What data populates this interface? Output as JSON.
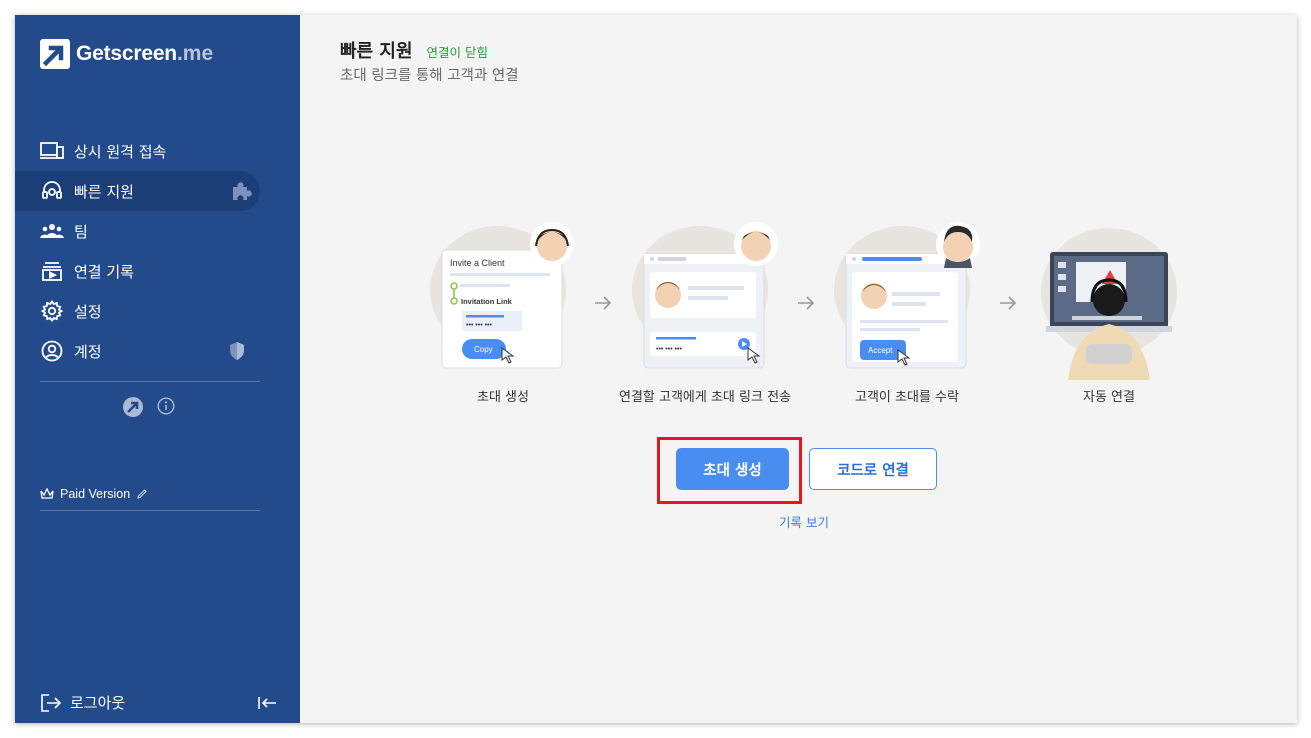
{
  "brand": {
    "name": "Getscreen",
    "suffix": ".me"
  },
  "sidebar": {
    "items": [
      {
        "label": "상시 원격 접속",
        "icon": "devices-icon"
      },
      {
        "label": "빠른 지원",
        "icon": "headset-icon",
        "active": true
      },
      {
        "label": "팀",
        "icon": "team-icon"
      },
      {
        "label": "연결 기록",
        "icon": "history-icon"
      },
      {
        "label": "설정",
        "icon": "gear-icon"
      },
      {
        "label": "계정",
        "icon": "account-icon"
      }
    ],
    "plan": "Paid Version",
    "logout": "로그아웃"
  },
  "main": {
    "title": "빠른 지원",
    "status": "연결이 닫힘",
    "subtitle": "초대 링크를 통해 고객과 연결",
    "steps": [
      {
        "label": "초대 생성",
        "card_title": "Invite a Client",
        "card_link": "Invitation Link",
        "card_code": "••• ••• •••",
        "card_button": "Copy"
      },
      {
        "label": "연결할 고객에게 초대 링크 전송",
        "card_code": "••• ••• •••"
      },
      {
        "label": "고객이 초대를 수락",
        "card_button": "Accept"
      },
      {
        "label": "자동 연결"
      }
    ],
    "primary_button": "초대 생성",
    "secondary_button": "코드로 연결",
    "history_link": "기록 보기"
  },
  "colors": {
    "sidebar": "#234a8a",
    "accent": "#4a8df0",
    "status": "#2a9a3a",
    "highlight": "#e01a1a"
  }
}
